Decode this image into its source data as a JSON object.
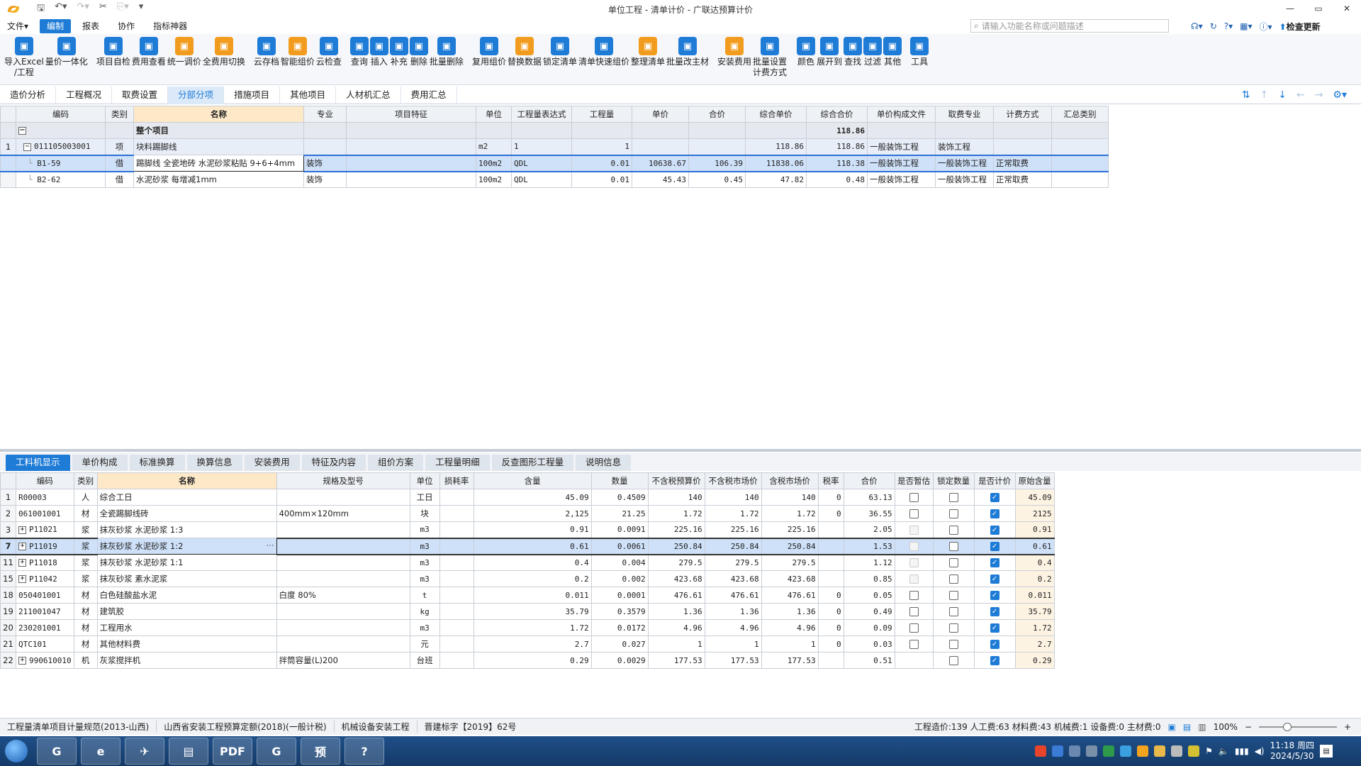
{
  "window": {
    "title": "单位工程 - 清单计价 - 广联达预算计价",
    "controls": [
      "—",
      "▭",
      "✕"
    ]
  },
  "menu": {
    "items": [
      "文件▾",
      "编制",
      "报表",
      "协作",
      "指标神器"
    ],
    "search_placeholder": "请输入功能名称或问题描述",
    "update_label": "检查更新"
  },
  "ribbon": [
    {
      "label": "导入Excel\n/工程",
      "icon": "import-excel-icon",
      "color": "#1e7bd6"
    },
    {
      "label": "量价一体化",
      "icon": "quantity-price-icon",
      "color": "#1e7bd6"
    },
    {
      "label": "项目自检",
      "icon": "self-check-icon",
      "color": "#1e7bd6"
    },
    {
      "label": "费用查看",
      "icon": "cost-view-icon",
      "color": "#1e7bd6"
    },
    {
      "label": "统一调价",
      "icon": "unify-price-icon",
      "color": "#f29c1f"
    },
    {
      "label": "全费用切换",
      "icon": "full-cost-icon",
      "color": "#f29c1f"
    },
    {
      "label": "云存档",
      "icon": "cloud-save-icon",
      "color": "#1e7bd6"
    },
    {
      "label": "智能组价",
      "icon": "smart-price-icon",
      "color": "#f29c1f"
    },
    {
      "label": "云检查",
      "icon": "cloud-check-icon",
      "color": "#1e7bd6"
    },
    {
      "label": "查询",
      "icon": "query-icon",
      "color": "#1e7bd6"
    },
    {
      "label": "插入",
      "icon": "insert-icon",
      "color": "#1e7bd6"
    },
    {
      "label": "补充",
      "icon": "supplement-icon",
      "color": "#1e7bd6"
    },
    {
      "label": "删除",
      "icon": "delete-icon",
      "color": "#1e7bd6"
    },
    {
      "label": "批量删除",
      "icon": "batch-delete-icon",
      "color": "#1e7bd6"
    },
    {
      "label": "复用组价",
      "icon": "reuse-price-icon",
      "color": "#1e7bd6"
    },
    {
      "label": "替换数据",
      "icon": "replace-data-icon",
      "color": "#f29c1f"
    },
    {
      "label": "锁定清单",
      "icon": "lock-list-icon",
      "color": "#1e7bd6"
    },
    {
      "label": "清单快速组价",
      "icon": "quick-price-icon",
      "color": "#1e7bd6"
    },
    {
      "label": "整理清单",
      "icon": "organize-list-icon",
      "color": "#f29c1f"
    },
    {
      "label": "批量改主材",
      "icon": "batch-material-icon",
      "color": "#1e7bd6"
    },
    {
      "label": "安装费用",
      "icon": "install-cost-icon",
      "color": "#f29c1f"
    },
    {
      "label": "批量设置\n计费方式",
      "icon": "batch-billing-icon",
      "color": "#1e7bd6"
    },
    {
      "label": "颜色",
      "icon": "color-icon",
      "color": "#1e7bd6"
    },
    {
      "label": "展开到",
      "icon": "expand-icon",
      "color": "#1e7bd6"
    },
    {
      "label": "查找",
      "icon": "find-icon",
      "color": "#1e7bd6"
    },
    {
      "label": "过滤",
      "icon": "filter-icon",
      "color": "#1e7bd6"
    },
    {
      "label": "其他",
      "icon": "other-icon",
      "color": "#1e7bd6"
    },
    {
      "label": "工具",
      "icon": "tools-icon",
      "color": "#1e7bd6"
    }
  ],
  "tabs1": [
    "造价分析",
    "工程概况",
    "取费设置",
    "分部分项",
    "措施项目",
    "其他项目",
    "人材机汇总",
    "费用汇总"
  ],
  "tabs1_active": 3,
  "upper": {
    "headers": [
      "编码",
      "类别",
      "名称",
      "专业",
      "项目特征",
      "单位",
      "工程量表达式",
      "工程量",
      "单价",
      "合价",
      "综合单价",
      "综合合价",
      "单价构成文件",
      "取费专业",
      "计费方式",
      "汇总类别"
    ],
    "total": {
      "name": "整个项目",
      "amount": "118.86"
    },
    "rows": [
      {
        "no": "1",
        "code": "011105003001",
        "type": "项",
        "name": "块料踢脚线",
        "major": "",
        "feature": "",
        "unit": "m2",
        "expr": "1",
        "qty": "1",
        "price": "",
        "total": "",
        "cunit": "118.86",
        "ctotal": "118.86",
        "file": "一般装饰工程",
        "fee": "装饰工程",
        "method": "",
        "cat": ""
      },
      {
        "no": "",
        "code": "B1-59",
        "type": "借",
        "name": "踢脚线 全瓷地砖 水泥砂浆粘贴 9+6+4mm",
        "major": "装饰",
        "feature": "",
        "unit": "100m2",
        "expr": "QDL",
        "qty": "0.01",
        "price": "10638.67",
        "total": "106.39",
        "cunit": "11838.06",
        "ctotal": "118.38",
        "file": "一般装饰工程",
        "fee": "一般装饰工程",
        "method": "正常取费",
        "cat": ""
      },
      {
        "no": "",
        "code": "B2-62",
        "type": "借",
        "name": "水泥砂浆 每增减1mm",
        "major": "装饰",
        "feature": "",
        "unit": "100m2",
        "expr": "QDL",
        "qty": "0.01",
        "price": "45.43",
        "total": "0.45",
        "cunit": "47.82",
        "ctotal": "0.48",
        "file": "一般装饰工程",
        "fee": "一般装饰工程",
        "method": "正常取费",
        "cat": ""
      }
    ]
  },
  "tabs2": [
    "工料机显示",
    "单价构成",
    "标准换算",
    "换算信息",
    "安装费用",
    "特征及内容",
    "组价方案",
    "工程量明细",
    "反查图形工程量",
    "说明信息"
  ],
  "tabs2_active": 0,
  "lower": {
    "headers": [
      "编码",
      "类别",
      "名称",
      "规格及型号",
      "单位",
      "损耗率",
      "含量",
      "数量",
      "不含税预算价",
      "不含税市场价",
      "含税市场价",
      "税率",
      "合价",
      "是否暂估",
      "锁定数量",
      "是否计价",
      "原始含量"
    ],
    "rows": [
      {
        "no": "1",
        "code": "R00003",
        "exp": false,
        "type": "人",
        "name": "综合工日",
        "spec": "",
        "unit": "工日",
        "loss": "",
        "content": "45.09",
        "qty": "0.4509",
        "bp": "140",
        "mp": "140",
        "tp": "140",
        "tax": "0",
        "sum": "63.13",
        "est": "on",
        "lock": "on",
        "billed": true,
        "orig": "45.09"
      },
      {
        "no": "2",
        "code": "061001001",
        "exp": false,
        "type": "材",
        "name": "全瓷踢脚线砖",
        "spec": "400mm×120mm",
        "unit": "块",
        "loss": "",
        "content": "2,125",
        "qty": "21.25",
        "bp": "1.72",
        "mp": "1.72",
        "tp": "1.72",
        "tax": "0",
        "sum": "36.55",
        "est": "on",
        "lock": "on",
        "billed": true,
        "orig": "2125"
      },
      {
        "no": "3",
        "code": "P11021",
        "exp": true,
        "type": "浆",
        "name": "抹灰砂浆 水泥砂浆 1:3",
        "spec": "",
        "unit": "m3",
        "loss": "",
        "content": "0.91",
        "qty": "0.0091",
        "bp": "225.16",
        "mp": "225.16",
        "tp": "225.16",
        "tax": "",
        "sum": "2.05",
        "est": "dis",
        "lock": "on",
        "billed": true,
        "orig": "0.91"
      },
      {
        "no": "7",
        "code": "P11019",
        "exp": true,
        "type": "浆",
        "name": "抹灰砂浆 水泥砂浆 1:2",
        "spec": "",
        "unit": "m3",
        "loss": "",
        "content": "0.61",
        "qty": "0.0061",
        "bp": "250.84",
        "mp": "250.84",
        "tp": "250.84",
        "tax": "",
        "sum": "1.53",
        "est": "dis",
        "lock": "on",
        "billed": true,
        "orig": "0.61",
        "sel": true
      },
      {
        "no": "11",
        "code": "P11018",
        "exp": true,
        "type": "浆",
        "name": "抹灰砂浆 水泥砂浆 1:1",
        "spec": "",
        "unit": "m3",
        "loss": "",
        "content": "0.4",
        "qty": "0.004",
        "bp": "279.5",
        "mp": "279.5",
        "tp": "279.5",
        "tax": "",
        "sum": "1.12",
        "est": "dis",
        "lock": "on",
        "billed": true,
        "orig": "0.4"
      },
      {
        "no": "15",
        "code": "P11042",
        "exp": true,
        "type": "浆",
        "name": "抹灰砂浆 素水泥浆",
        "spec": "",
        "unit": "m3",
        "loss": "",
        "content": "0.2",
        "qty": "0.002",
        "bp": "423.68",
        "mp": "423.68",
        "tp": "423.68",
        "tax": "",
        "sum": "0.85",
        "est": "dis",
        "lock": "on",
        "billed": true,
        "orig": "0.2"
      },
      {
        "no": "18",
        "code": "050401001",
        "exp": false,
        "type": "材",
        "name": "白色硅酸盐水泥",
        "spec": "白度 80%",
        "unit": "t",
        "loss": "",
        "content": "0.011",
        "qty": "0.0001",
        "bp": "476.61",
        "mp": "476.61",
        "tp": "476.61",
        "tax": "0",
        "sum": "0.05",
        "est": "on",
        "lock": "on",
        "billed": true,
        "orig": "0.011"
      },
      {
        "no": "19",
        "code": "211001047",
        "exp": false,
        "type": "材",
        "name": "建筑胶",
        "spec": "",
        "unit": "kg",
        "loss": "",
        "content": "35.79",
        "qty": "0.3579",
        "bp": "1.36",
        "mp": "1.36",
        "tp": "1.36",
        "tax": "0",
        "sum": "0.49",
        "est": "on",
        "lock": "on",
        "billed": true,
        "orig": "35.79"
      },
      {
        "no": "20",
        "code": "230201001",
        "exp": false,
        "type": "材",
        "name": "工程用水",
        "spec": "",
        "unit": "m3",
        "loss": "",
        "content": "1.72",
        "qty": "0.0172",
        "bp": "4.96",
        "mp": "4.96",
        "tp": "4.96",
        "tax": "0",
        "sum": "0.09",
        "est": "on",
        "lock": "on",
        "billed": true,
        "orig": "1.72"
      },
      {
        "no": "21",
        "code": "QTC101",
        "exp": false,
        "type": "材",
        "name": "其他材料费",
        "spec": "",
        "unit": "元",
        "loss": "",
        "content": "2.7",
        "qty": "0.027",
        "bp": "1",
        "mp": "1",
        "tp": "1",
        "tax": "0",
        "sum": "0.03",
        "est": "on",
        "lock": "on",
        "billed": true,
        "orig": "2.7"
      },
      {
        "no": "22",
        "code": "990610010",
        "exp": true,
        "type": "机",
        "name": "灰浆搅拌机",
        "spec": "拌筒容量(L)200",
        "unit": "台班",
        "loss": "",
        "content": "0.29",
        "qty": "0.0029",
        "bp": "177.53",
        "mp": "177.53",
        "tp": "177.53",
        "tax": "",
        "sum": "0.51",
        "est": "none",
        "lock": "on",
        "billed": true,
        "orig": "0.29"
      }
    ]
  },
  "status": {
    "items": [
      "工程量清单项目计量规范(2013-山西)",
      "山西省安装工程预算定额(2018)(一般计税)",
      "机械设备安装工程",
      "晋建标字【2019】62号"
    ],
    "summary": "工程造价:139  人工费:63  材料费:43  机械费:1  设备费:0  主材费:0",
    "zoom": "100%"
  },
  "taskbar": {
    "apps": [
      {
        "name": "glodon-browser",
        "glyph": "G"
      },
      {
        "name": "ie-browser",
        "glyph": "e"
      },
      {
        "name": "task-app",
        "glyph": "✈"
      },
      {
        "name": "file-explorer",
        "glyph": "▤"
      },
      {
        "name": "pdf-reader",
        "glyph": "PDF"
      },
      {
        "name": "glodon-app",
        "glyph": "G"
      },
      {
        "name": "budget-app",
        "glyph": "预"
      },
      {
        "name": "help-app",
        "glyph": "?"
      }
    ],
    "time": "11:18 周四",
    "date": "2024/5/30"
  }
}
